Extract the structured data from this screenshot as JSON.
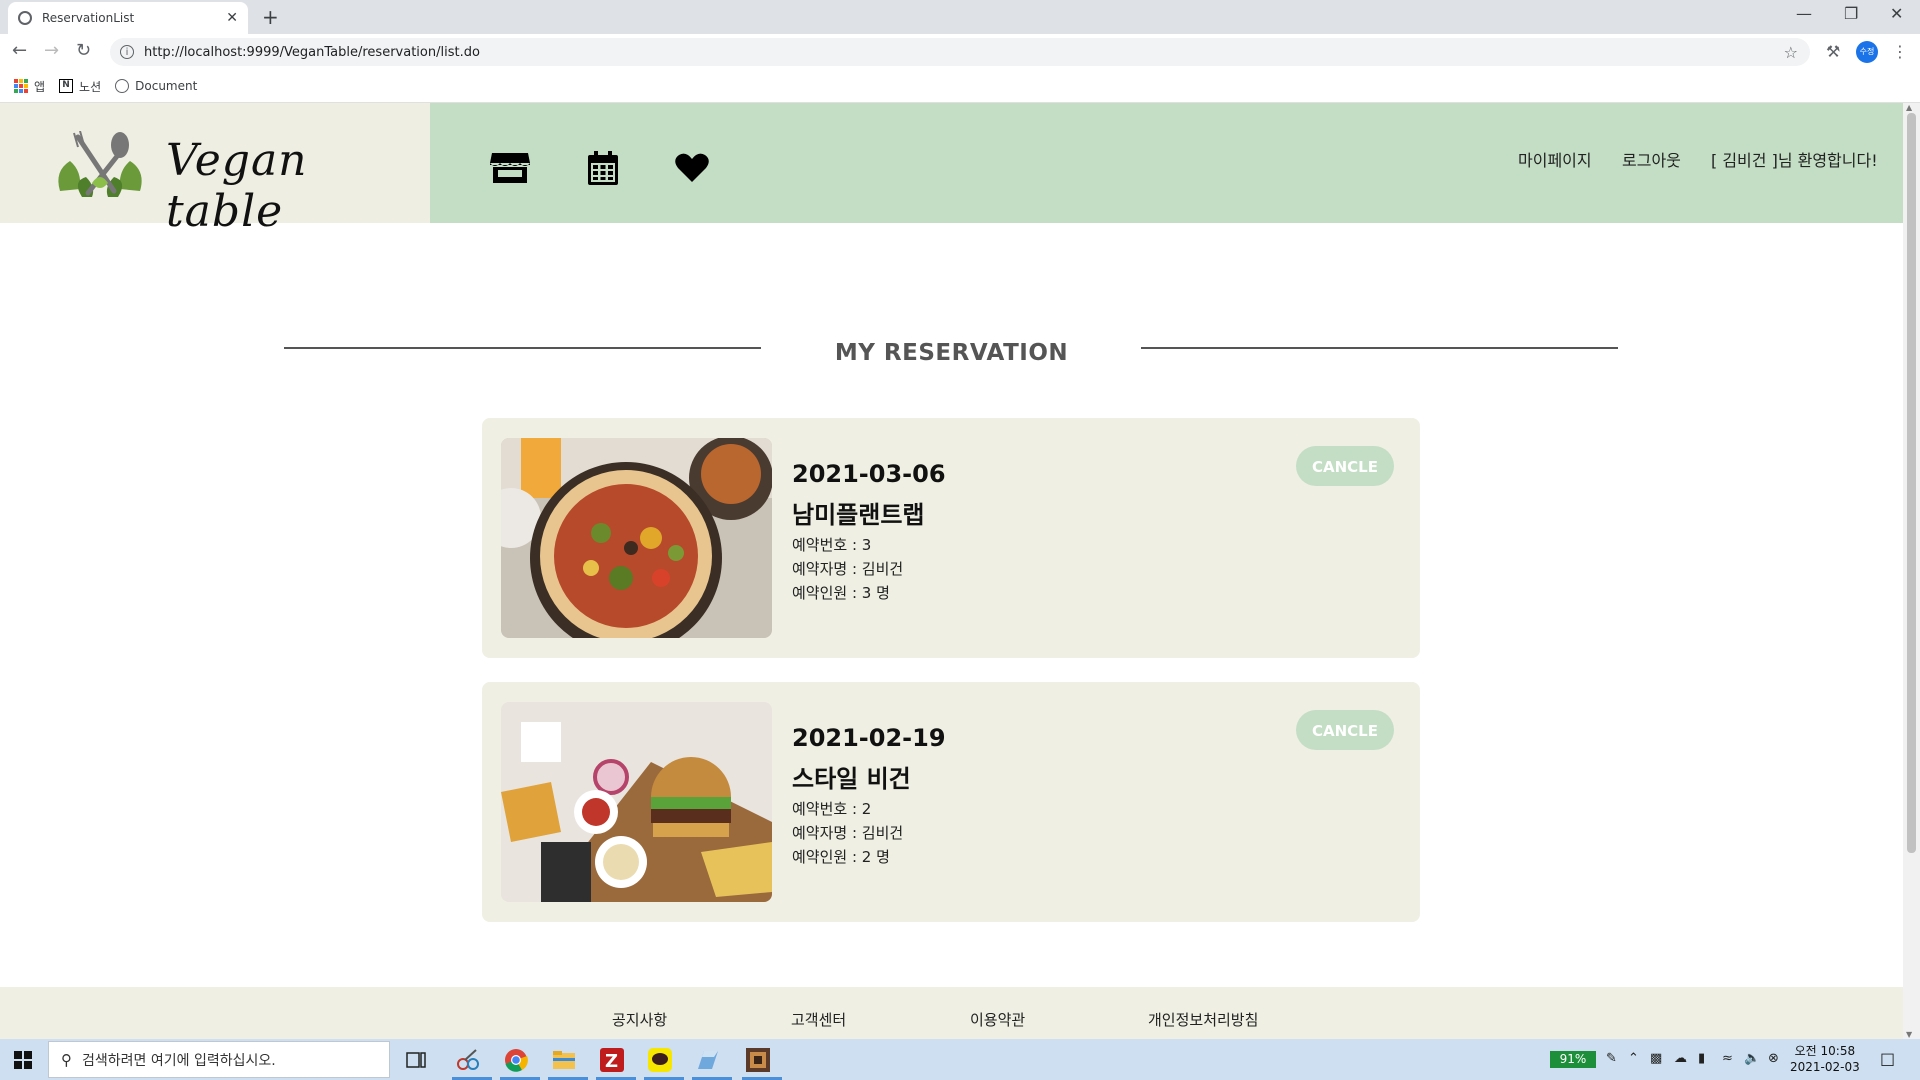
{
  "browser": {
    "tab_title": "ReservationList",
    "tab_close": "✕",
    "new_tab": "+",
    "url": "http://localhost:9999/VeganTable/reservation/list.do",
    "bookmarks": [
      {
        "label": "앱"
      },
      {
        "label": "노션"
      },
      {
        "label": "Document"
      }
    ],
    "profile_label": "수정"
  },
  "header": {
    "logo_text": "Vegan table",
    "nav_links": [
      "마이페이지",
      "로그아웃",
      "[ 김비건 ]님 환영합니다!"
    ],
    "colors": {
      "logo_bg": "#efeee3",
      "nav_bg": "#c3dec4"
    }
  },
  "main": {
    "section_title": "MY RESERVATION",
    "reservations": [
      {
        "date": "2021-03-06",
        "store": "남미플랜트랩",
        "number_line": "예약번호 : 3",
        "name_line": "예약자명 : 김비건",
        "people_line": "예약인원 : 3 명",
        "cancel_label": "CANCLE"
      },
      {
        "date": "2021-02-19",
        "store": "스타일 비건",
        "number_line": "예약번호 : 2",
        "name_line": "예약자명 : 김비건",
        "people_line": "예약인원 : 2 명",
        "cancel_label": "CANCLE"
      }
    ]
  },
  "footer": {
    "links": [
      "공지사항",
      "고객센터",
      "이용약관",
      "개인정보처리방침"
    ]
  },
  "taskbar": {
    "search_placeholder": "검색하려면 여기에 입력하십시오.",
    "battery": "91%",
    "time": "오전 10:58",
    "date": "2021-02-03"
  }
}
